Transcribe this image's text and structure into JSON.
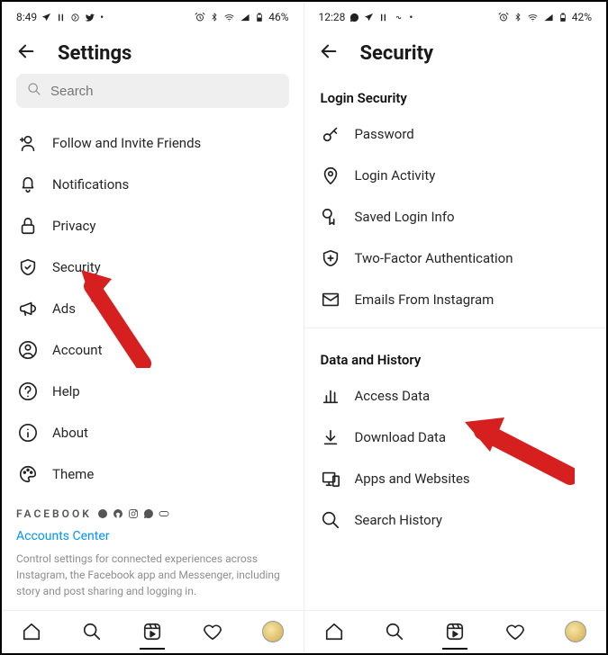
{
  "left": {
    "status": {
      "time": "8:49",
      "battery": "46%"
    },
    "header": {
      "title": "Settings"
    },
    "search": {
      "placeholder": "Search"
    },
    "items": [
      {
        "label": "Follow and Invite Friends"
      },
      {
        "label": "Notifications"
      },
      {
        "label": "Privacy"
      },
      {
        "label": "Security"
      },
      {
        "label": "Ads"
      },
      {
        "label": "Account"
      },
      {
        "label": "Help"
      },
      {
        "label": "About"
      },
      {
        "label": "Theme"
      }
    ],
    "footer": {
      "brand": "FACEBOOK",
      "link": "Accounts Center",
      "desc": "Control settings for connected experiences across Instagram, the Facebook app and Messenger, including story and post sharing and logging in."
    }
  },
  "right": {
    "status": {
      "time": "12:28",
      "battery": "42%"
    },
    "header": {
      "title": "Security"
    },
    "section1": "Login Security",
    "items1": [
      {
        "label": "Password"
      },
      {
        "label": "Login Activity"
      },
      {
        "label": "Saved Login Info"
      },
      {
        "label": "Two-Factor Authentication"
      },
      {
        "label": "Emails From Instagram"
      }
    ],
    "section2": "Data and History",
    "items2": [
      {
        "label": "Access Data"
      },
      {
        "label": "Download Data"
      },
      {
        "label": "Apps and Websites"
      },
      {
        "label": "Search History"
      }
    ]
  }
}
